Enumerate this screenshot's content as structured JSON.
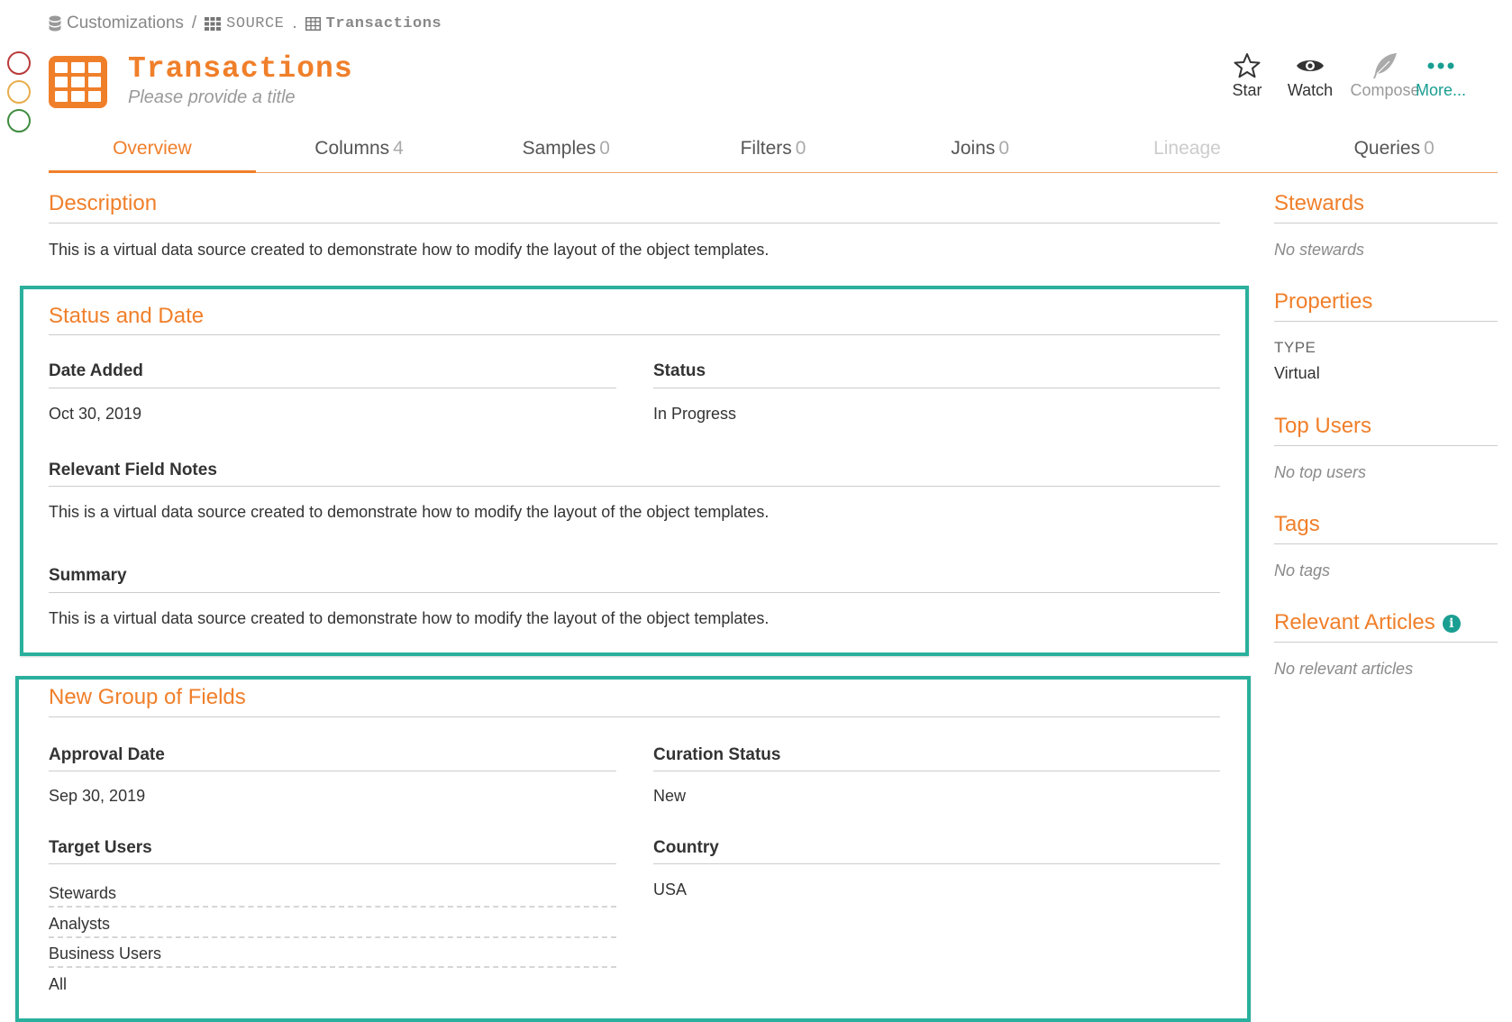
{
  "breadcrumb": {
    "root": "Customizations",
    "source": "SOURCE",
    "table": "Transactions",
    "sep1": "/",
    "sep2": "."
  },
  "header": {
    "title": "Transactions",
    "subtitle_placeholder": "Please provide a title",
    "icon": "table-icon"
  },
  "actions": [
    {
      "label": "Star",
      "icon": "star-icon"
    },
    {
      "label": "Watch",
      "icon": "eye-icon"
    },
    {
      "label": "Compose",
      "icon": "feather-icon"
    },
    {
      "label": "More...",
      "icon": "dots-icon"
    }
  ],
  "tabs": [
    {
      "label": "Overview",
      "count": ""
    },
    {
      "label": "Columns",
      "count": "4"
    },
    {
      "label": "Samples",
      "count": "0"
    },
    {
      "label": "Filters",
      "count": "0"
    },
    {
      "label": "Joins",
      "count": "0"
    },
    {
      "label": "Lineage",
      "count": ""
    },
    {
      "label": "Queries",
      "count": "0"
    }
  ],
  "description": {
    "title": "Description",
    "text": "This is a virtual data source created to demonstrate how to modify the layout of the object templates."
  },
  "status_date": {
    "title": "Status and Date",
    "date_added_label": "Date Added",
    "date_added_value": "Oct 30, 2019",
    "status_label": "Status",
    "status_value": "In Progress",
    "field_notes_label": "Relevant Field Notes",
    "field_notes_value": "This is a virtual data source created to demonstrate how to modify the layout of the object templates.",
    "summary_label": "Summary",
    "summary_value": "This is a virtual data source created to demonstrate how to modify the layout of the object templates."
  },
  "new_group": {
    "title": "New Group of Fields",
    "approval_date_label": "Approval Date",
    "approval_date_value": "Sep 30, 2019",
    "curation_status_label": "Curation Status",
    "curation_status_value": "New",
    "target_users_label": "Target Users",
    "target_users": [
      "Stewards",
      "Analysts",
      "Business Users",
      "All"
    ],
    "country_label": "Country",
    "country_value": "USA"
  },
  "sidebar": {
    "stewards_title": "Stewards",
    "stewards_empty": "No stewards",
    "properties_title": "Properties",
    "type_label": "TYPE",
    "type_value": "Virtual",
    "top_users_title": "Top Users",
    "top_users_empty": "No top users",
    "tags_title": "Tags",
    "tags_empty": "No tags",
    "articles_title": "Relevant Articles",
    "articles_empty": "No relevant articles"
  },
  "colors": {
    "accent": "#f07f2a",
    "teal": "#1a9e92",
    "highlight_border": "#2ab09d"
  }
}
